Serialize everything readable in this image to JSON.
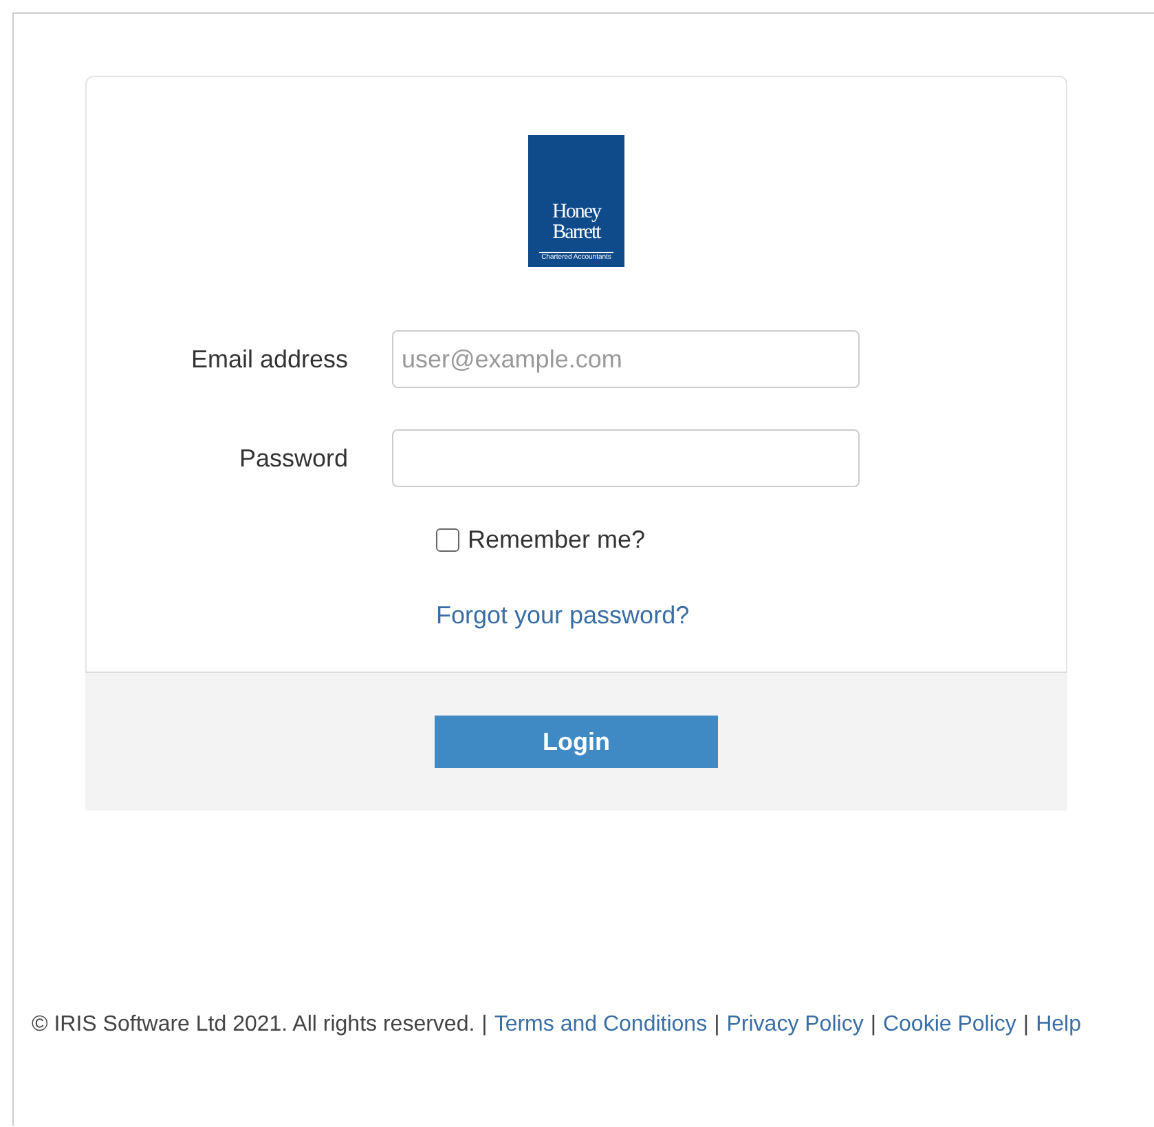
{
  "logo": {
    "line_1": "Honey",
    "line_2": "Barrett",
    "tagline": "Chartered Accountants"
  },
  "form": {
    "email": {
      "label": "Email address",
      "placeholder": "user@example.com"
    },
    "password": {
      "label": "Password"
    },
    "remember": {
      "label": "Remember me?",
      "checked": false
    },
    "forgot_link": "Forgot your password?",
    "login_button": "Login"
  },
  "footer": {
    "copyright": "© IRIS Software Ltd 2021. All rights reserved.",
    "separator": "|",
    "links": [
      "Terms and Conditions",
      "Privacy Policy",
      "Cookie Policy",
      "Help"
    ]
  }
}
